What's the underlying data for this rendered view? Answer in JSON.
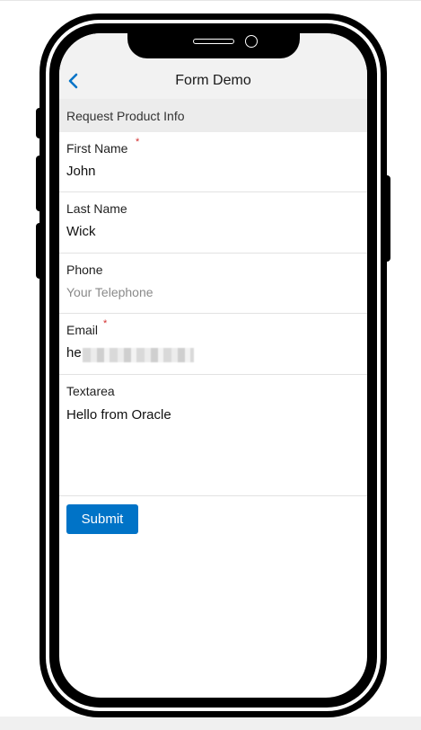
{
  "header": {
    "title": "Form Demo",
    "back_icon": "chevron-left-icon"
  },
  "section": {
    "title": "Request Product Info"
  },
  "fields": {
    "first_name": {
      "label": "First Name",
      "required": "*",
      "value": "John"
    },
    "last_name": {
      "label": "Last Name",
      "value": "Wick"
    },
    "phone": {
      "label": "Phone",
      "value": "",
      "placeholder": "Your Telephone"
    },
    "email": {
      "label": "Email",
      "required": "*",
      "value": "he"
    },
    "textarea": {
      "label": "Textarea",
      "value": "Hello from Oracle"
    }
  },
  "submit": {
    "label": "Submit"
  },
  "colors": {
    "accent": "#0073c7",
    "required": "#d32f2f",
    "header_bg": "#f2f2f2",
    "section_bg": "#ececec"
  }
}
